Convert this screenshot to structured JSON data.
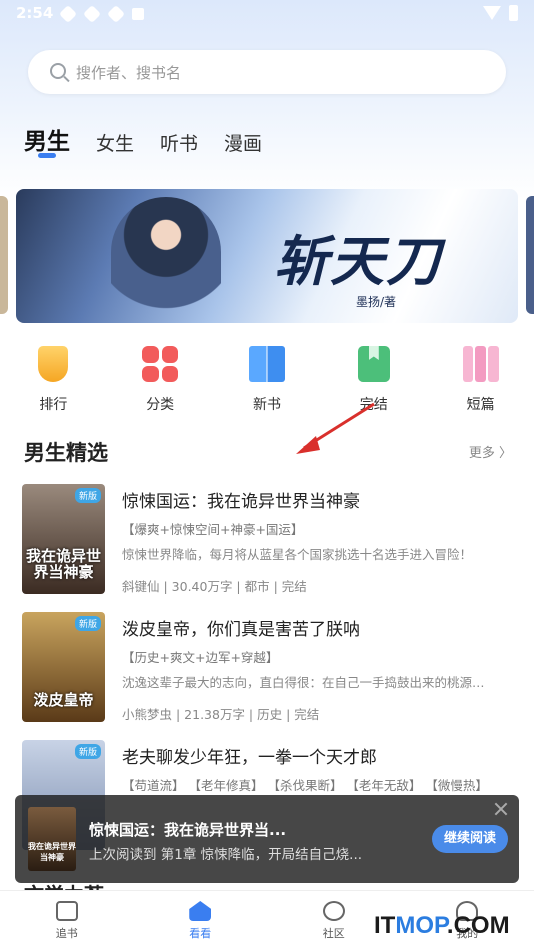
{
  "status_bar": {
    "time": "2:54"
  },
  "search": {
    "placeholder": "搜作者、搜书名"
  },
  "tabs": [
    {
      "label": "男生",
      "active": true
    },
    {
      "label": "女生"
    },
    {
      "label": "听书"
    },
    {
      "label": "漫画"
    }
  ],
  "banner": {
    "title": "斩天刀",
    "author": "墨扬/著"
  },
  "categories": [
    {
      "label": "排行",
      "icon": "trophy-icon"
    },
    {
      "label": "分类",
      "icon": "grid-icon"
    },
    {
      "label": "新书",
      "icon": "book-icon"
    },
    {
      "label": "完结",
      "icon": "bookmark-icon"
    },
    {
      "label": "短篇",
      "icon": "short-books-icon"
    }
  ],
  "section": {
    "title": "男生精选",
    "more": "更多 〉"
  },
  "books": [
    {
      "title": "惊悚国运：我在诡异世界当神豪",
      "tags": "【爆爽+惊悚空间+神豪+国运】",
      "desc": "惊悚世界降临，每月将从蓝星各个国家挑选十名选手进入冒险！",
      "meta": "斜键仙 | 30.40万字 | 都市 | 完结",
      "cover_text": "我在诡异世界当神豪",
      "cover_tag": "新版",
      "cover_color": "#3b2b22"
    },
    {
      "title": "泼皮皇帝，你们真是害苦了朕呐",
      "tags": "【历史+爽文+边军+穿越】",
      "desc": "沈逸这辈子最大的志向，直白得很：在自己一手捣鼓出来的桃源…",
      "meta": "小熊梦虫 | 21.38万字 | 历史 | 完结",
      "cover_text": "泼皮皇帝",
      "cover_tag": "新版",
      "cover_color": "#5a3a18"
    },
    {
      "title": "老夫聊发少年狂，一拳一个天才郎",
      "tags": "【苟道流】 【老年修真】 【杀伐果断】 【老年无敌】 【微慢热】",
      "desc": "",
      "meta": "",
      "cover_text": "",
      "cover_tag": "新版",
      "cover_color": "#7d8fb0"
    }
  ],
  "continue_reading": {
    "title": "惊悚国运：我在诡异世界当...",
    "subtitle": "上次阅读到 第1章 惊悚降临，开局结自己烧...",
    "button": "继续阅读",
    "cover_text": "我在诡异世界当神豪"
  },
  "next_section_peek": "文学力荐",
  "bottom_nav": [
    {
      "label": "追书",
      "icon": "bookshelf-icon"
    },
    {
      "label": "看看",
      "icon": "home-icon",
      "active": true
    },
    {
      "label": "社区",
      "icon": "community-icon"
    },
    {
      "label": "我的",
      "icon": "profile-icon"
    }
  ],
  "watermark": {
    "prefix": "IT",
    "accent": "MOP",
    "suffix": ".COM"
  },
  "colors": {
    "accent": "#3a7ef0",
    "continue_button": "#4a8be9"
  }
}
